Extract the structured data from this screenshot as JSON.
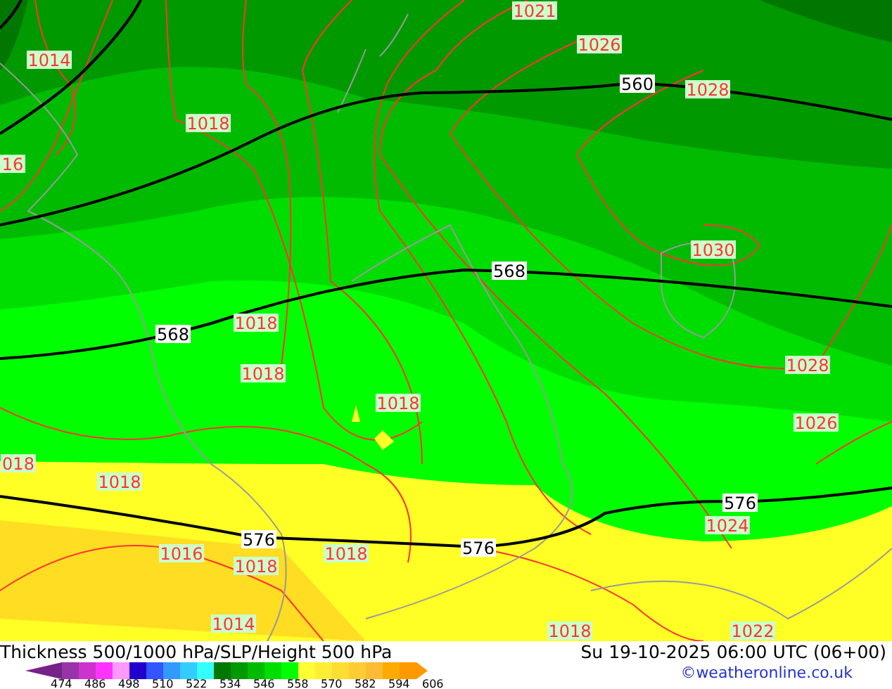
{
  "map": {
    "labels": [
      {
        "text": "1021",
        "kind": "pressure"
      },
      {
        "text": "1014",
        "kind": "pressure"
      },
      {
        "text": "1026",
        "kind": "pressure"
      },
      {
        "text": "560",
        "kind": "thickness"
      },
      {
        "text": "1028",
        "kind": "pressure"
      },
      {
        "text": "1018",
        "kind": "pressure"
      },
      {
        "text": "16",
        "kind": "pressure"
      },
      {
        "text": "1030",
        "kind": "pressure"
      },
      {
        "text": "568",
        "kind": "thickness"
      },
      {
        "text": "568",
        "kind": "thickness"
      },
      {
        "text": "1018",
        "kind": "pressure"
      },
      {
        "text": "1018",
        "kind": "pressure"
      },
      {
        "text": "1018",
        "kind": "pressure"
      },
      {
        "text": "1028",
        "kind": "pressure"
      },
      {
        "text": "1026",
        "kind": "pressure"
      },
      {
        "text": "018",
        "kind": "pressure"
      },
      {
        "text": "1018",
        "kind": "pressure"
      },
      {
        "text": "576",
        "kind": "thickness"
      },
      {
        "text": "1024",
        "kind": "pressure"
      },
      {
        "text": "576",
        "kind": "thickness"
      },
      {
        "text": "576",
        "kind": "thickness"
      },
      {
        "text": "1016",
        "kind": "pressure"
      },
      {
        "text": "1018",
        "kind": "pressure"
      },
      {
        "text": "1018",
        "kind": "pressure"
      },
      {
        "text": "1014",
        "kind": "pressure"
      },
      {
        "text": "1018",
        "kind": "pressure"
      },
      {
        "text": "1022",
        "kind": "pressure"
      }
    ]
  },
  "footer": {
    "title": "Thickness 500/1000 hPa/SLP/Height 500 hPa",
    "valid_time": "Su 19-10-2025 06:00 UTC (06+00)",
    "credit": "©weatheronline.co.uk"
  },
  "legend": {
    "swatches": [
      {
        "color": "#9933aa"
      },
      {
        "color": "#cc33cc"
      },
      {
        "color": "#ff33ff"
      },
      {
        "color": "#ff99ff"
      },
      {
        "color": "#2200cc"
      },
      {
        "color": "#3355ff"
      },
      {
        "color": "#3399ff"
      },
      {
        "color": "#33ccff"
      },
      {
        "color": "#33ffff"
      },
      {
        "color": "#007700"
      },
      {
        "color": "#009900"
      },
      {
        "color": "#00bb00"
      },
      {
        "color": "#00dd00"
      },
      {
        "color": "#00ff00"
      },
      {
        "color": "#ffff33"
      },
      {
        "color": "#ffee33"
      },
      {
        "color": "#ffdd33"
      },
      {
        "color": "#ffcc33"
      },
      {
        "color": "#ffbb33"
      },
      {
        "color": "#ffaa00"
      },
      {
        "color": "#ff9900"
      }
    ],
    "ticks": [
      "474",
      "486",
      "498",
      "510",
      "522",
      "534",
      "546",
      "558",
      "570",
      "582",
      "594",
      "606"
    ]
  }
}
